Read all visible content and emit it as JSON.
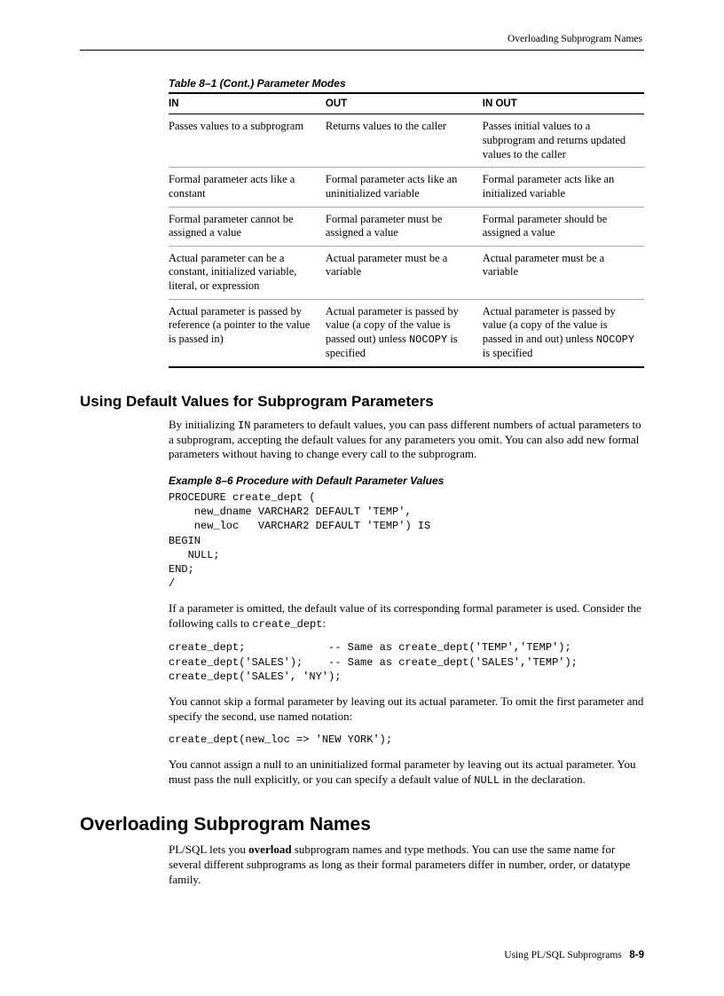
{
  "runningHead": "Overloading Subprogram Names",
  "table": {
    "caption": "Table 8–1    (Cont.)  Parameter Modes",
    "headers": [
      "IN",
      "OUT",
      "IN OUT"
    ],
    "rows": [
      [
        "Passes values to a subprogram",
        "Returns values to the caller",
        "Passes initial values to a subprogram and returns updated values to the caller"
      ],
      [
        "Formal parameter acts like a constant",
        "Formal parameter acts like an uninitialized variable",
        "Formal parameter acts like an initialized variable"
      ],
      [
        "Formal parameter cannot be assigned a value",
        "Formal parameter must be assigned a value",
        "Formal parameter should be assigned a value"
      ],
      [
        "Actual parameter can be a constant, initialized variable, literal, or expression",
        "Actual parameter must be a variable",
        "Actual parameter must be a variable"
      ]
    ],
    "lastRow": {
      "c1": "Actual parameter is passed by reference (a pointer to the value is passed in)",
      "c2a": "Actual parameter is passed by value (a copy of the value is passed out) unless ",
      "c2code": "NOCOPY",
      "c2b": " is specified",
      "c3a": "Actual parameter is passed by value (a copy of the value is passed in and out) unless ",
      "c3code": "NOCOPY",
      "c3b": " is specified"
    }
  },
  "sec1": {
    "heading": "Using Default Values for Subprogram Parameters",
    "p1a": "By initializing ",
    "p1code": "IN",
    "p1b": " parameters to default values, you can pass different numbers of actual parameters to a subprogram, accepting the default values for any parameters you omit. You can also add new formal parameters without having to change every call to the subprogram.",
    "exCaption": "Example 8–6    Procedure with Default Parameter Values",
    "code1": "PROCEDURE create_dept (\n    new_dname VARCHAR2 DEFAULT 'TEMP',\n    new_loc   VARCHAR2 DEFAULT 'TEMP') IS\nBEGIN\n   NULL;\nEND;\n/",
    "p2a": "If a parameter is omitted, the default value of its corresponding formal parameter is used. Consider the following calls to ",
    "p2code": "create_dept",
    "p2b": ":",
    "code2": "create_dept;             -- Same as create_dept('TEMP','TEMP');\ncreate_dept('SALES');    -- Same as create_dept('SALES','TEMP');\ncreate_dept('SALES', 'NY');",
    "p3": "You cannot skip a formal parameter by leaving out its actual parameter. To omit the first parameter and specify the second, use named notation:",
    "code3": "create_dept(new_loc => 'NEW YORK');",
    "p4a": "You cannot assign a null to an uninitialized formal parameter by leaving out its actual parameter. You must pass the null explicitly, or you can specify a default value of ",
    "p4code": "NULL",
    "p4b": " in the declaration."
  },
  "sec2": {
    "heading": "Overloading Subprogram Names",
    "p1a": "PL/SQL lets you ",
    "p1bold": "overload",
    "p1b": " subprogram names and type methods. You can use the same name for several different subprograms as long as their formal parameters differ in number, order, or datatype family."
  },
  "footer": {
    "chapter": "Using PL/SQL Subprograms",
    "page": "8-9"
  }
}
